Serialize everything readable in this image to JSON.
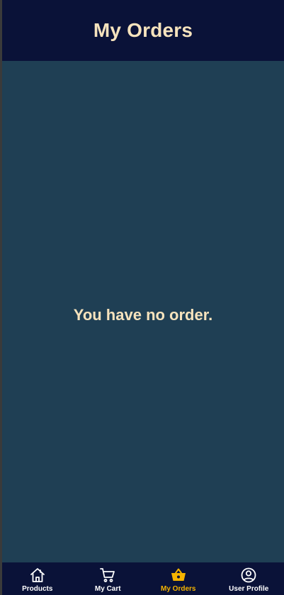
{
  "header": {
    "title": "My Orders"
  },
  "main": {
    "empty_message": "You have no order."
  },
  "bottom_nav": {
    "items": [
      {
        "label": "Products",
        "icon": "home-icon",
        "active": false
      },
      {
        "label": "My Cart",
        "icon": "cart-icon",
        "active": false
      },
      {
        "label": "My Orders",
        "icon": "basket-icon",
        "active": true
      },
      {
        "label": "User Profile",
        "icon": "user-circle-icon",
        "active": false
      }
    ]
  },
  "colors": {
    "header_bg": "#0a1238",
    "content_bg": "#1f3f54",
    "text_cream": "#f6e3bd",
    "active_accent": "#f5b400",
    "inactive_nav": "#ffffff"
  }
}
